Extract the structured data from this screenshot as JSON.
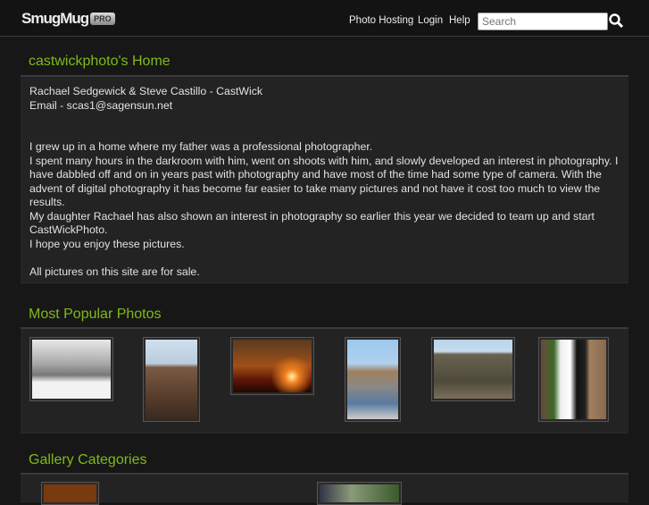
{
  "header": {
    "logo": "SmugMug",
    "logo_badge": "PRO",
    "nav": [
      "Photo Hosting",
      "Login",
      "Help"
    ],
    "search_placeholder": "Search"
  },
  "home": {
    "title": "castwickphoto's Home",
    "lines": [
      "Rachael Sedgewick & Steve Castillo - CastWick",
      "Email - scas1@sagensun.net",
      "",
      "",
      "I grew up in a home where my father was a professional photographer.",
      "I spent many hours in the darkroom with him, went on shoots with him, and slowly developed an interest in photography. I have dabbled off and on in years past with photography and have most of the time had some type of camera. With the advent of digital photography it has become far easier to take many pictures and not have it cost too much to view the results.",
      "My daughter Rachael has also shown an interest in photography so earlier this year we decided to team up and start CastWickPhoto.",
      "I hope you enjoy these pictures.",
      "",
      "All pictures on this site are for sale."
    ]
  },
  "popular": {
    "title": "Most Popular Photos"
  },
  "categories": {
    "title": "Gallery Categories"
  }
}
